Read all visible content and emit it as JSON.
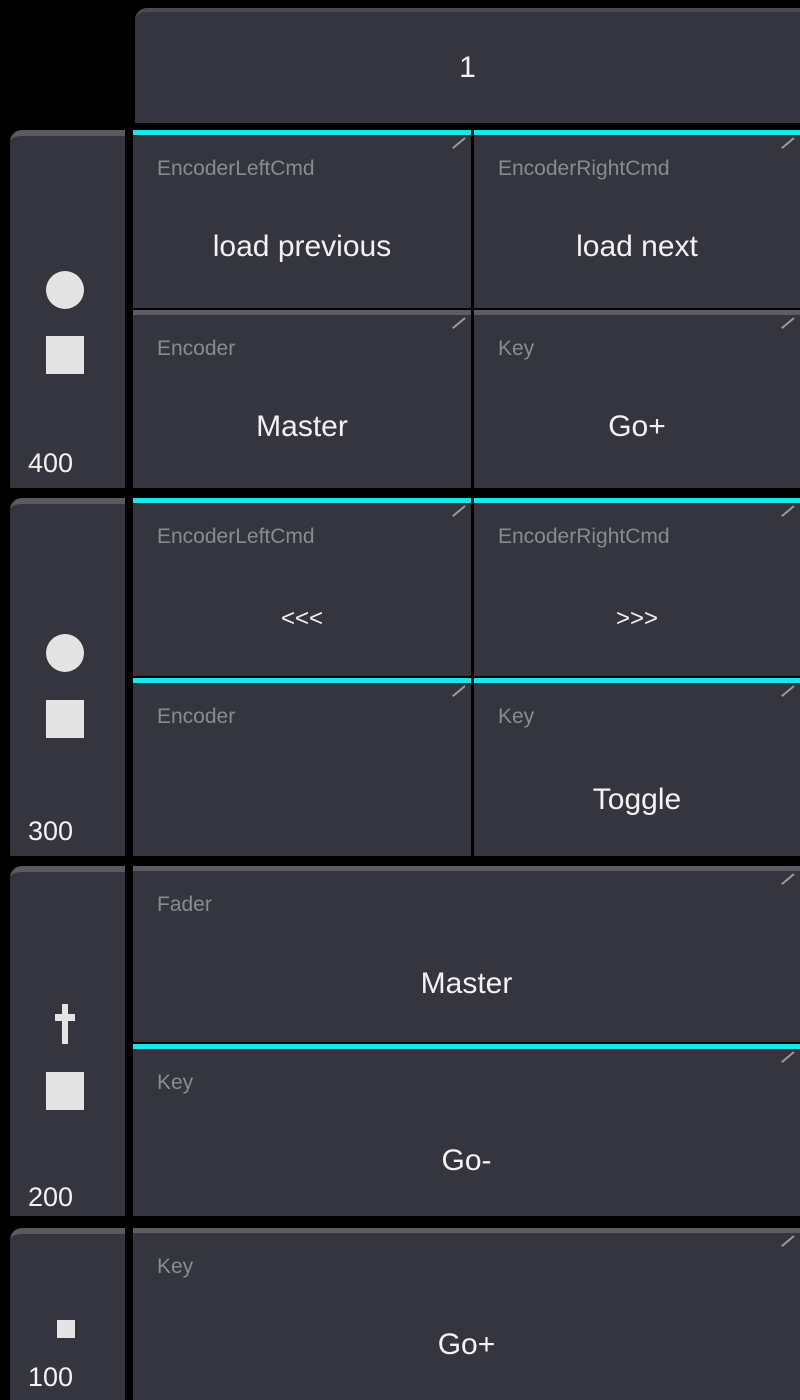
{
  "header": {
    "title": "1"
  },
  "sections": [
    {
      "number": "400",
      "cells": [
        {
          "label": "EncoderLeftCmd",
          "value": "load previous"
        },
        {
          "label": "EncoderRightCmd",
          "value": "load next"
        },
        {
          "label": "Encoder",
          "value": "Master"
        },
        {
          "label": "Key",
          "value": "Go+"
        }
      ]
    },
    {
      "number": "300",
      "cells": [
        {
          "label": "EncoderLeftCmd",
          "value": "<<<"
        },
        {
          "label": "EncoderRightCmd",
          "value": ">>>"
        },
        {
          "label": "Encoder",
          "value": ""
        },
        {
          "label": "Key",
          "value": "Toggle"
        }
      ]
    },
    {
      "number": "200",
      "cells": [
        {
          "label": "Fader",
          "value": "Master"
        },
        {
          "label": "Key",
          "value": "Go-"
        }
      ]
    },
    {
      "number": "100",
      "cells": [
        {
          "label": "Key",
          "value": "Go+"
        }
      ]
    }
  ],
  "colors": {
    "accent": "#19e6ef",
    "panel": "#35353f",
    "label": "#8a8a92"
  },
  "icons": [
    "circle-icon",
    "square-icon",
    "fader-icon",
    "small-square-icon"
  ]
}
